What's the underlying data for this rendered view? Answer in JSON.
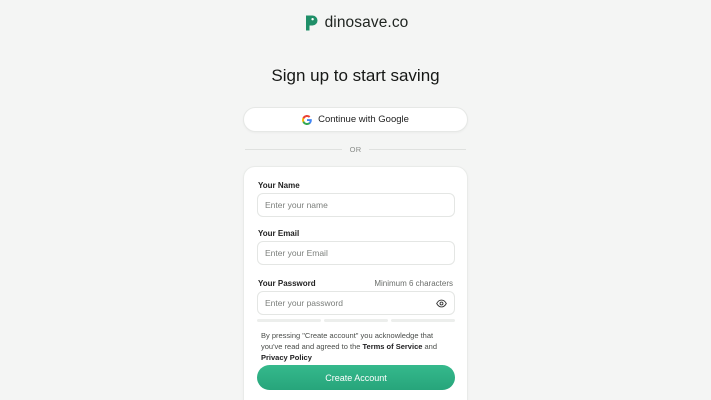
{
  "brand": {
    "name": "dinosave.co",
    "logo_icon": "dinosave-logo-icon",
    "color": "#1f8f68"
  },
  "title": "Sign up to start saving",
  "google_button": {
    "label": "Continue with Google",
    "icon": "google-icon"
  },
  "divider": {
    "text": "OR"
  },
  "form": {
    "name": {
      "label": "Your Name",
      "placeholder": "Enter your name",
      "value": ""
    },
    "email": {
      "label": "Your Email",
      "placeholder": "Enter your Email",
      "value": ""
    },
    "password": {
      "label": "Your Password",
      "hint": "Minimum 6 characters",
      "placeholder": "Enter your password",
      "value": "",
      "toggle_icon": "eye-icon"
    },
    "legal": {
      "prefix": "By pressing \"Create account\" you acknowledge that you've read and agreed to the ",
      "terms": "Terms of Service",
      "and": " and ",
      "privacy": "Privacy Policy"
    },
    "submit": {
      "label": "Create Account",
      "color": "#2cae82"
    }
  }
}
